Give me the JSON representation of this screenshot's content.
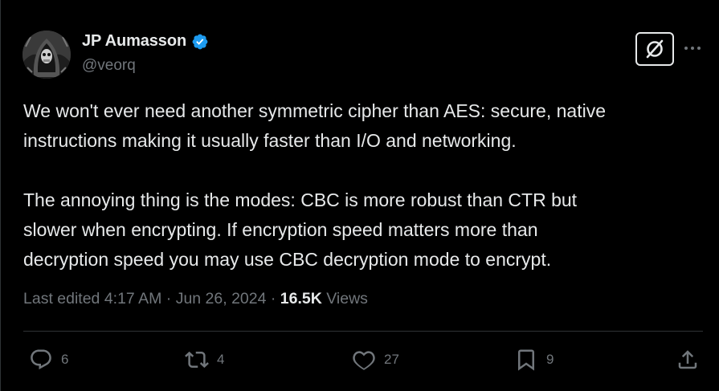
{
  "author": {
    "name": "JP Aumasson",
    "handle": "@veorq",
    "verified_color": "#1d9bf0"
  },
  "tweet": {
    "paragraphs": [
      "We won't ever need another symmetric cipher than AES: secure, native\ninstructions making it usually faster than I/O and networking.",
      "The annoying thing is the modes: CBC is more robust than CTR but\nslower when encrypting. If encryption speed matters more than\ndecryption speed you may use CBC decryption mode to encrypt."
    ]
  },
  "meta": {
    "edited": "Last edited 4:17 AM · Jun 26, 2024 · ",
    "views_count": "16.5K",
    "views_label": " Views"
  },
  "actions": {
    "replies": "6",
    "reposts": "4",
    "likes": "27",
    "bookmarks": "9"
  },
  "icons": {
    "grok": "grok-icon",
    "more": "more-icon",
    "reply": "reply-icon",
    "repost": "repost-icon",
    "like": "heart-icon",
    "bookmark": "bookmark-icon",
    "share": "share-icon"
  },
  "colors": {
    "background": "#000000",
    "text": "#e7e9ea",
    "muted": "#71767b",
    "border": "#2f3336"
  }
}
